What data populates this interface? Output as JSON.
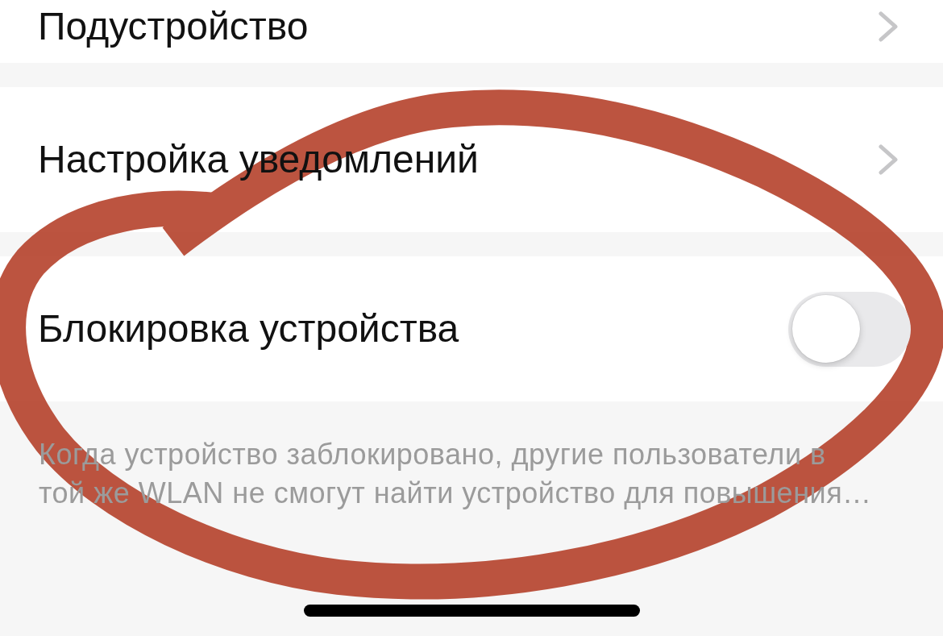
{
  "rows": [
    {
      "kind": "link",
      "label": "Подустройство"
    },
    {
      "kind": "link",
      "label": "Настройка уведомлений"
    },
    {
      "kind": "switch",
      "label": "Блокировка устройства",
      "on": false
    }
  ],
  "footnote": "Когда устройство заблокировано, другие пользователи в той же WLAN не смогут найти устройство для повышения…"
}
